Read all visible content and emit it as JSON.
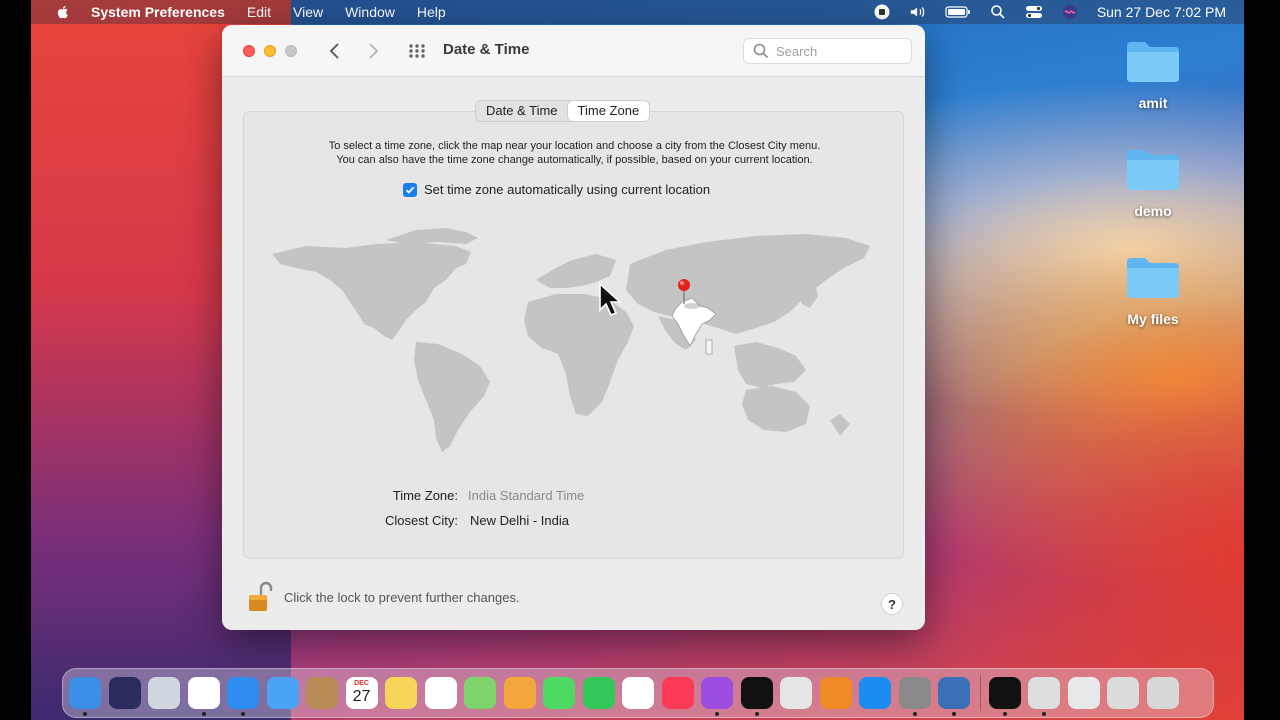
{
  "menubar": {
    "app_name": "System Preferences",
    "items": [
      "Edit",
      "View",
      "Window",
      "Help"
    ],
    "clock": "Sun 27 Dec  7:02 PM",
    "icons": [
      "apple-icon",
      "screen-record-icon",
      "volume-icon",
      "battery-icon",
      "spotlight-icon",
      "control-center-icon",
      "siri-icon"
    ]
  },
  "window": {
    "title": "Date & Time",
    "search_placeholder": "Search",
    "tabs": [
      {
        "label": "Date & Time",
        "active": false
      },
      {
        "label": "Time Zone",
        "active": true
      }
    ],
    "instructions_line1": "To select a time zone, click the map near your location and choose a city from the Closest City menu.",
    "instructions_line2": "You can also have the time zone change automatically, if possible, based on your current location.",
    "auto_label": "Set time zone automatically using current location",
    "auto_checked": true,
    "time_zone_label": "Time Zone:",
    "time_zone_value": "India Standard Time",
    "closest_city_label": "Closest City:",
    "closest_city_value": "New Delhi - India",
    "lock_text": "Click the lock to prevent further changes.",
    "help_label": "?"
  },
  "desktop": {
    "icons": [
      {
        "label": "amit"
      },
      {
        "label": "demo"
      },
      {
        "label": "My files"
      }
    ]
  },
  "dock": {
    "calendar_month": "DEC",
    "calendar_day": "27",
    "apps": [
      {
        "name": "finder-icon",
        "color": "#3a8ee6",
        "running": true
      },
      {
        "name": "siri-icon",
        "color": "#2b2b5e",
        "running": false
      },
      {
        "name": "launchpad-icon",
        "color": "#cfd6df",
        "running": false
      },
      {
        "name": "chrome-icon",
        "color": "#ffffff",
        "running": true
      },
      {
        "name": "safari-icon",
        "color": "#2f8cf0",
        "running": true
      },
      {
        "name": "mail-icon",
        "color": "#4aa3f5",
        "running": false
      },
      {
        "name": "contacts-icon",
        "color": "#b88b57",
        "running": false
      },
      {
        "name": "calendar-icon",
        "color": "#ffffff",
        "running": false
      },
      {
        "name": "notes-icon",
        "color": "#f6d658",
        "running": false
      },
      {
        "name": "reminders-icon",
        "color": "#ffffff",
        "running": false
      },
      {
        "name": "maps-icon",
        "color": "#7ed36b",
        "running": false
      },
      {
        "name": "photos-icon",
        "color": "#f3a63b",
        "running": false
      },
      {
        "name": "messages-icon",
        "color": "#4cd964",
        "running": false
      },
      {
        "name": "facetime-icon",
        "color": "#34c759",
        "running": false
      },
      {
        "name": "freeform-icon",
        "color": "#ffffff",
        "running": false
      },
      {
        "name": "music-icon",
        "color": "#fb3b55",
        "running": false
      },
      {
        "name": "podcasts-icon",
        "color": "#9b4de0",
        "running": true
      },
      {
        "name": "tv-icon",
        "color": "#111111",
        "running": true
      },
      {
        "name": "screenshot-icon",
        "color": "#e5e5e5",
        "running": false
      },
      {
        "name": "books-icon",
        "color": "#f08a24",
        "running": false
      },
      {
        "name": "app-store-icon",
        "color": "#1d8cf0",
        "running": false
      },
      {
        "name": "system-preferences-icon",
        "color": "#8a8a8a",
        "running": true
      },
      {
        "name": "migration-icon",
        "color": "#3b6fb6",
        "running": true
      }
    ],
    "apps_right": [
      {
        "name": "terminal-icon",
        "color": "#111111",
        "running": true
      },
      {
        "name": "printer-icon",
        "color": "#dedede",
        "running": true
      },
      {
        "name": "document-icon",
        "color": "#e8e8e8",
        "running": false
      },
      {
        "name": "preview-icon",
        "color": "#dcdcdc",
        "running": false
      },
      {
        "name": "trash-icon",
        "color": "#d8d8d8",
        "running": false
      }
    ]
  }
}
